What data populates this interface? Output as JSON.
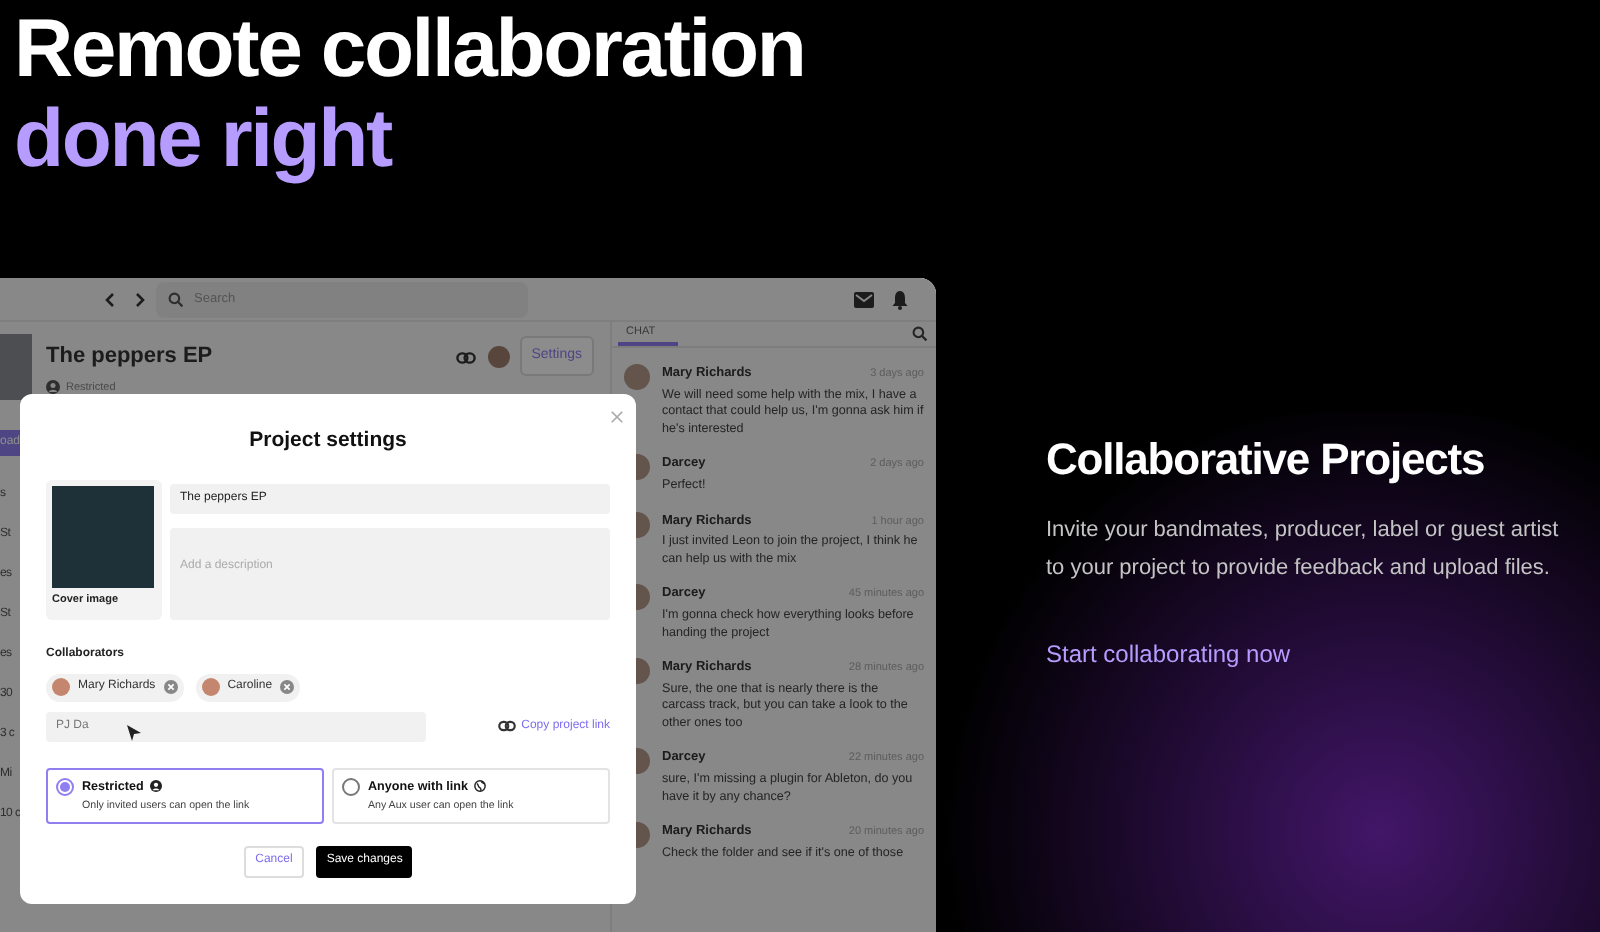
{
  "hero": {
    "title": "Remote collaboration",
    "highlight": "done right"
  },
  "feature": {
    "title": "Collaborative Projects",
    "description": "Invite your bandmates, producer, label or guest artist to your project to provide feedback and upload files.",
    "link": "Start collaborating now"
  },
  "app": {
    "topbar": {
      "search_placeholder": "Search"
    },
    "sidebar_fragments": [
      {
        "text": "oad",
        "kind": "button"
      },
      {
        "text": "s",
        "kind": "label"
      },
      {
        "text": "St",
        "kind": "label"
      },
      {
        "text": "es",
        "kind": "label"
      },
      {
        "text": "St",
        "kind": "label"
      },
      {
        "text": "es",
        "kind": "label"
      },
      {
        "text": "30",
        "kind": "label"
      },
      {
        "text": "3 c",
        "kind": "label"
      },
      {
        "text": "Mi",
        "kind": "label"
      },
      {
        "text": "10 c",
        "kind": "label"
      }
    ],
    "project": {
      "title": "The peppers EP",
      "access": "Restricted",
      "settings_button": "Settings"
    },
    "chat": {
      "tab": {
        "label": "CHAT",
        "selected": true
      },
      "messages": [
        {
          "author": "Mary Richards",
          "time": "3 days ago",
          "text": "We will need some help with the mix, I have a contact that could help us, I'm gonna ask him if he's interested"
        },
        {
          "author": "Darcey",
          "time": "2 days ago",
          "text": "Perfect!"
        },
        {
          "author": "Mary Richards",
          "time": "1 hour ago",
          "text": "I just invited Leon to join the project, I think he can help us with the mix"
        },
        {
          "author": "Darcey",
          "time": "45 minutes ago",
          "text": "I'm gonna check how everything looks before handing the project"
        },
        {
          "author": "Mary Richards",
          "time": "28 minutes ago",
          "text": "Sure, the one that is nearly there is the carcass track, but you can take a look to the other ones too"
        },
        {
          "author": "Darcey",
          "time": "22 minutes ago",
          "text": "sure, I'm missing a plugin for Ableton, do you have it by any chance?"
        },
        {
          "author": "Mary Richards",
          "time": "20 minutes ago",
          "text": "Check the folder and see if it's one of those"
        }
      ]
    },
    "modal": {
      "title": "Project settings",
      "name_value": "The peppers EP",
      "description_placeholder": "Add a description",
      "cover_label": "Cover image",
      "collaborators_label": "Collaborators",
      "collaborators": [
        {
          "name": "Mary Richards"
        },
        {
          "name": "Caroline"
        }
      ],
      "invite_value": "PJ Da",
      "copy_link": "Copy project link",
      "access_options": [
        {
          "kind": "restricted",
          "label": "Restricted",
          "description": "Only invited users can open the link",
          "selected": true
        },
        {
          "kind": "public",
          "label": "Anyone with link",
          "description": "Any Aux user can open the link",
          "selected": false
        }
      ],
      "cancel_button": "Cancel",
      "save_button": "Save changes"
    }
  }
}
